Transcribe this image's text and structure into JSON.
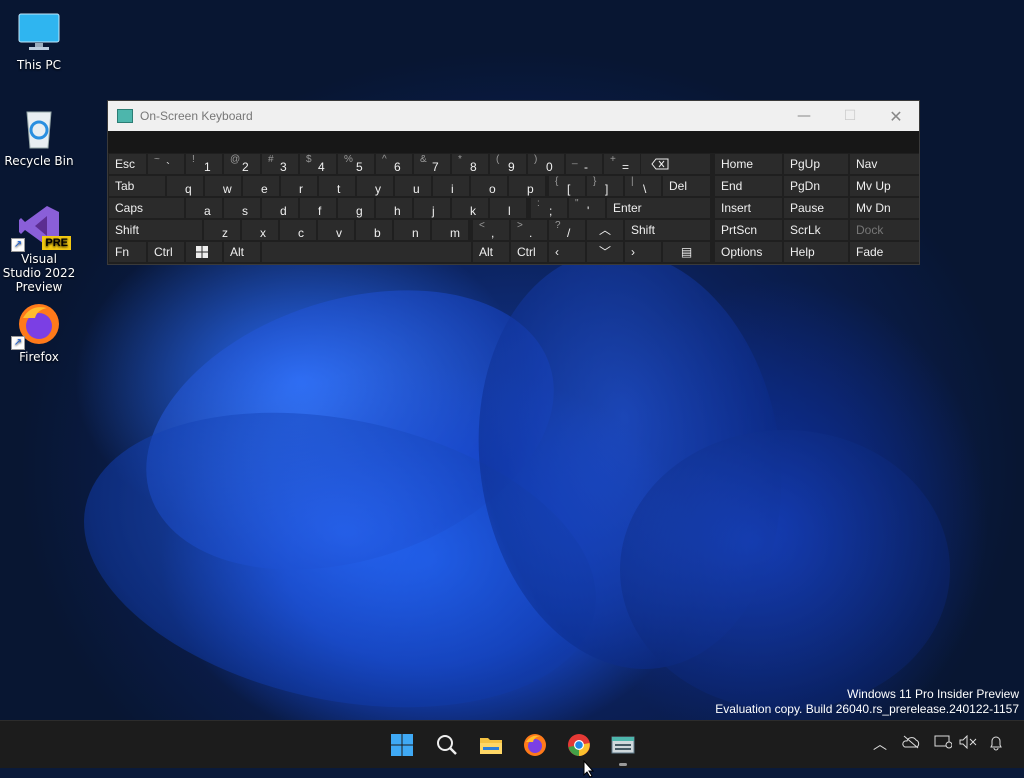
{
  "desktop_icons": [
    {
      "label": "This PC"
    },
    {
      "label": "Recycle Bin"
    },
    {
      "label": "Visual Studio 2022 Preview",
      "badge": "PRE"
    },
    {
      "label": "Firefox"
    }
  ],
  "osk": {
    "title": "On-Screen Keyboard",
    "minimize": "—",
    "maximize": "☐",
    "close": "✕",
    "row1": [
      {
        "sup": "~",
        "main": "`"
      },
      {
        "sup": "!",
        "main": "1"
      },
      {
        "sup": "@",
        "main": "2"
      },
      {
        "sup": "#",
        "main": "3"
      },
      {
        "sup": "$",
        "main": "4"
      },
      {
        "sup": "%",
        "main": "5"
      },
      {
        "sup": "^",
        "main": "6"
      },
      {
        "sup": "&",
        "main": "7"
      },
      {
        "sup": "*",
        "main": "8"
      },
      {
        "sup": "(",
        "main": "9"
      },
      {
        "sup": ")",
        "main": "0"
      },
      {
        "sup": "_",
        "main": "-"
      },
      {
        "sup": "+",
        "main": "="
      }
    ],
    "keys": {
      "esc": "Esc",
      "tab": "Tab",
      "del": "Del",
      "caps": "Caps",
      "enter": "Enter",
      "shift_left": "Shift",
      "shift_right": "Shift",
      "fn": "Fn",
      "ctrl_left": "Ctrl",
      "alt_left": "Alt",
      "alt_right": "Alt",
      "ctrl_right": "Ctrl",
      "row2": [
        "q",
        "w",
        "e",
        "r",
        "t",
        "y",
        "u",
        "i",
        "o",
        "p"
      ],
      "bracket_open": {
        "sup": "{",
        "main": "["
      },
      "bracket_close": {
        "sup": "}",
        "main": "]"
      },
      "pipe": {
        "sup": "|",
        "main": "\\"
      },
      "row3": [
        "a",
        "s",
        "d",
        "f",
        "g",
        "h",
        "j",
        "k",
        "l"
      ],
      "semicolon": {
        "sup": ":",
        "main": ";"
      },
      "quote": {
        "sup": "\"",
        "main": "'"
      },
      "row4": [
        "z",
        "x",
        "c",
        "v",
        "b",
        "n",
        "m"
      ],
      "comma": {
        "sup": "<",
        "main": ","
      },
      "period": {
        "sup": ">",
        "main": "."
      },
      "slash": {
        "sup": "?",
        "main": "/"
      }
    },
    "nav": {
      "home": "Home",
      "pgup": "PgUp",
      "nav": "Nav",
      "end": "End",
      "pgdn": "PgDn",
      "mvup": "Mv Up",
      "insert": "Insert",
      "pause": "Pause",
      "mvdn": "Mv Dn",
      "prtscn": "PrtScn",
      "scrlk": "ScrLk",
      "dock": "Dock",
      "options": "Options",
      "help": "Help",
      "fade": "Fade"
    }
  },
  "watermark": {
    "line1": "Windows 11 Pro Insider Preview",
    "line2": "Evaluation copy. Build 26040.rs_prerelease.240122-1157"
  },
  "colors": {
    "key_bg": "#2b2b2b",
    "osk_bg": "#1f1f1f",
    "taskbar_bg": "#1c1c1c",
    "accent": "#1a73e8"
  }
}
